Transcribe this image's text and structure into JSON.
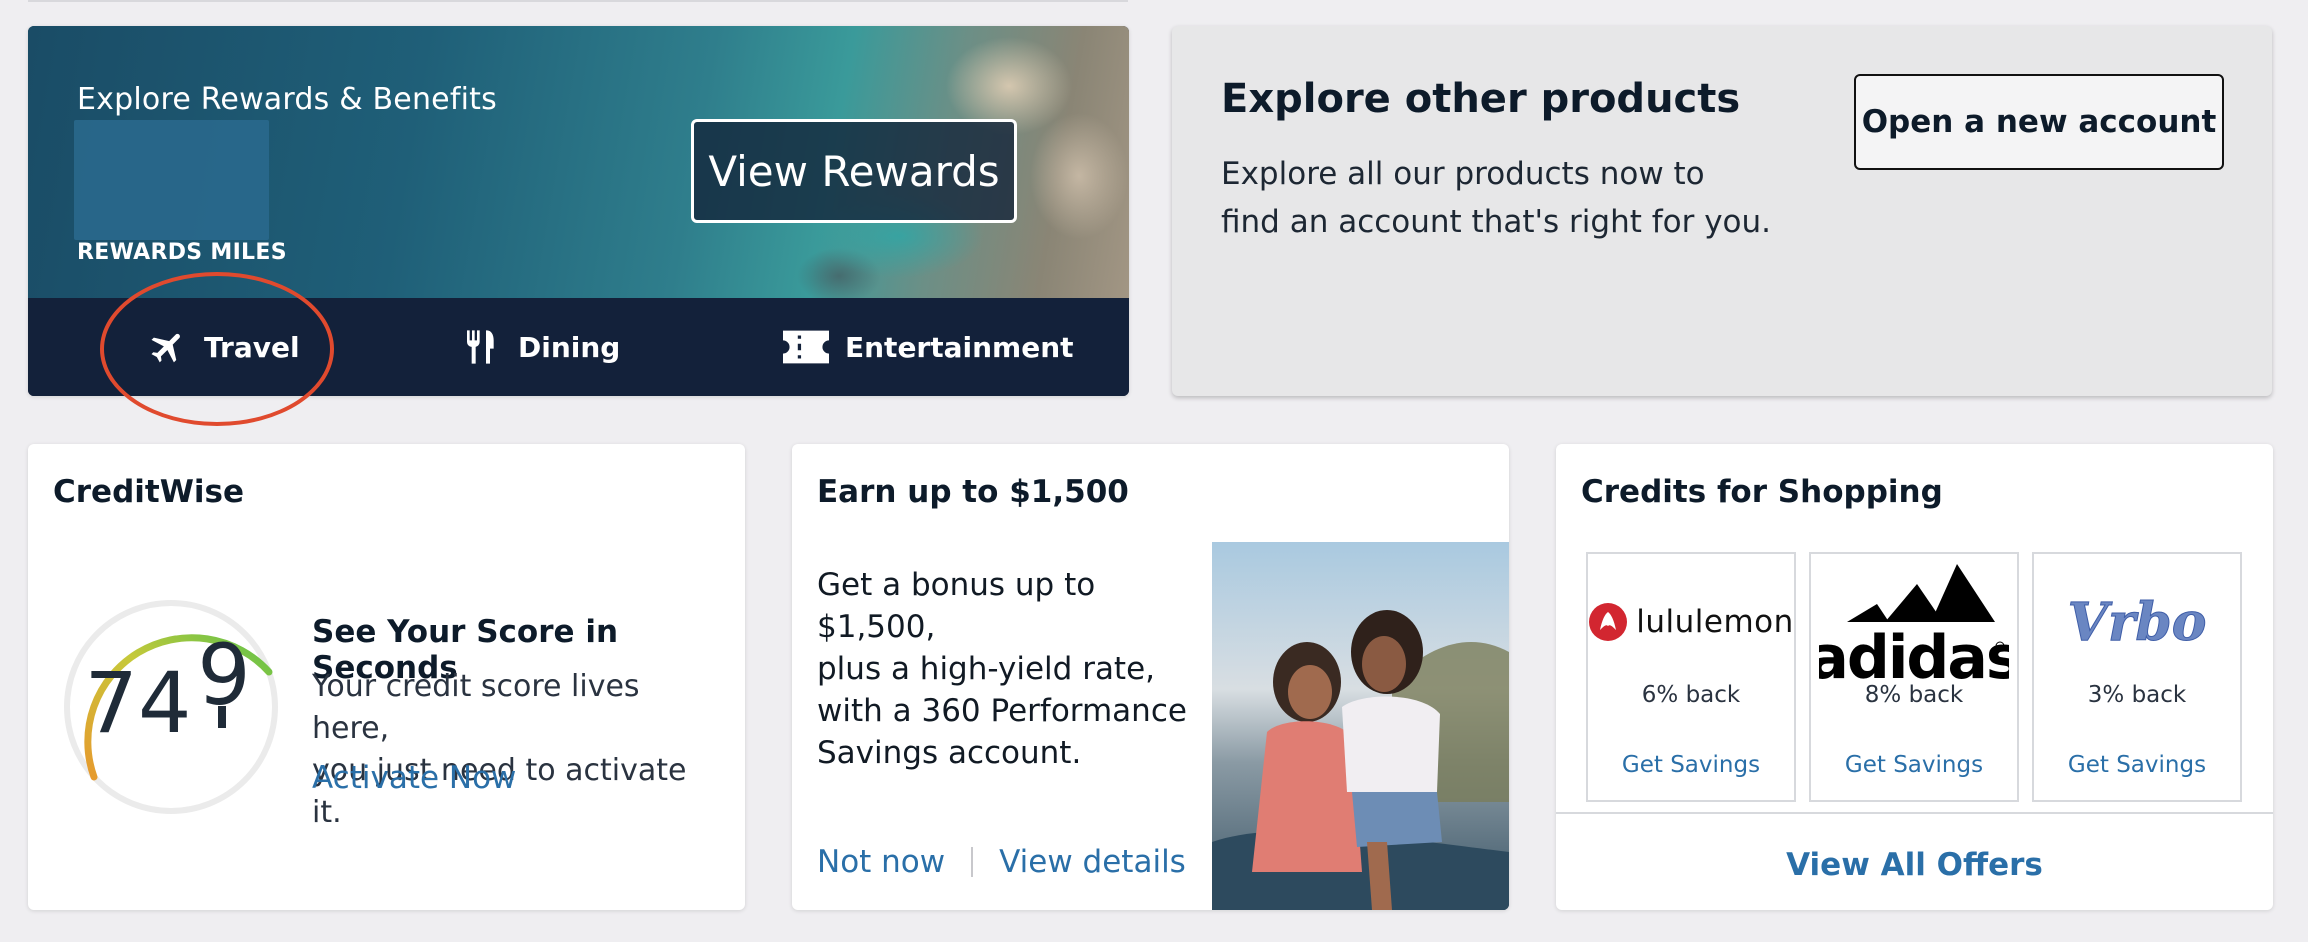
{
  "rewards": {
    "title": "Explore Rewards & Benefits",
    "miles_label": "REWARDS MILES",
    "view_button": "View Rewards",
    "categories": [
      {
        "label": "Travel",
        "icon": "airplane-icon"
      },
      {
        "label": "Dining",
        "icon": "fork-knife-icon"
      },
      {
        "label": "Entertainment",
        "icon": "ticket-icon"
      }
    ],
    "highlight_color": "#e04a2e"
  },
  "explore": {
    "title": "Explore other products",
    "text_line1": "Explore all our products now to",
    "text_line2": "find an account that's right for you.",
    "button": "Open a new account"
  },
  "creditwise": {
    "title": "CreditWise",
    "score_digits": "74",
    "score_partial": "9",
    "score_title": "See Your Score in Seconds",
    "desc_line1": "Your credit score lives here,",
    "desc_line2": "you just need to activate it.",
    "activate": "Activate Now"
  },
  "earn": {
    "title": "Earn up to $1,500",
    "line1": "Get a bonus up to $1,500,",
    "line2": "plus a high-yield rate,",
    "line3": "with a 360 Performance",
    "line4": "Savings account.",
    "not_now": "Not now",
    "view_details": "View details"
  },
  "shopping": {
    "title": "Credits for Shopping",
    "brands": [
      {
        "name": "lululemon",
        "back": "6% back",
        "link": "Get Savings"
      },
      {
        "name": "adidas",
        "back": "8% back",
        "link": "Get Savings"
      },
      {
        "name": "Vrbo",
        "back": "3% back",
        "link": "Get Savings"
      }
    ],
    "view_all": "View All Offers"
  },
  "colors": {
    "navy": "#13213a",
    "link": "#2a6fa8",
    "page_bg": "#efeef1"
  }
}
